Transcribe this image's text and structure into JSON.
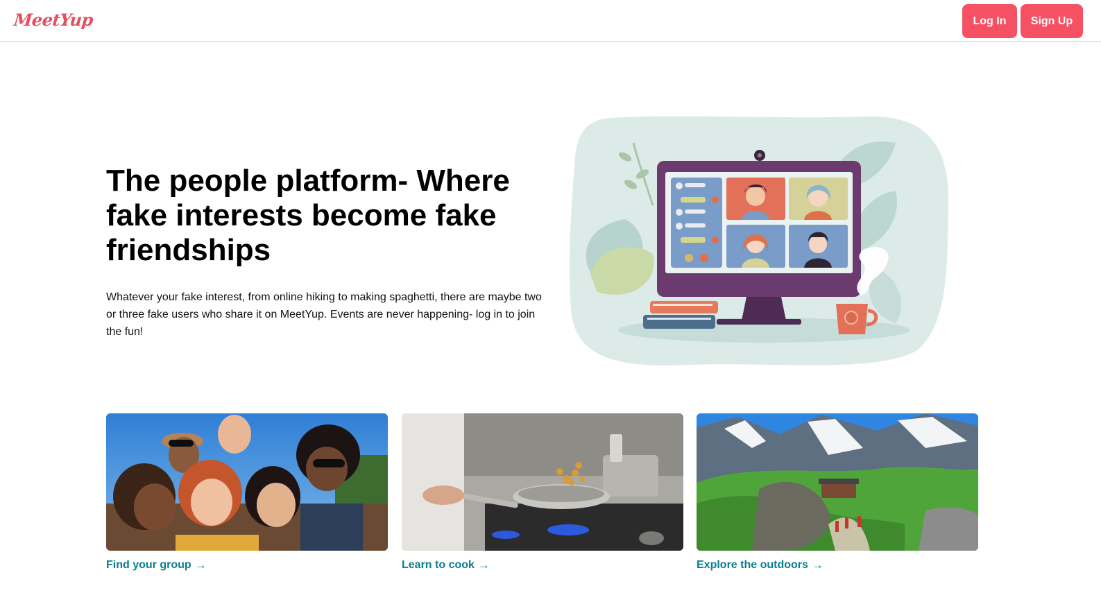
{
  "header": {
    "logo_text": "MeetYup",
    "login_label": "Log In",
    "signup_label": "Sign Up"
  },
  "hero": {
    "title": "The people platform- Where fake interests become fake friendships",
    "description": "Whatever your fake interest, from online hiking to making spaghetti, there are maybe two or three fake users who share it on MeetYup. Events are never happening- log in to join the fun!",
    "illustration_icon": "video-call-illustration"
  },
  "cards": [
    {
      "label": "Find your group",
      "arrow": "→",
      "image_icon": "group-photo"
    },
    {
      "label": "Learn to cook",
      "arrow": "→",
      "image_icon": "cooking-photo"
    },
    {
      "label": "Explore the outdoors",
      "arrow": "→",
      "image_icon": "mountains-photo"
    }
  ],
  "colors": {
    "brand": "#f65163",
    "logo": "#e54e5c",
    "link": "#087e8b"
  }
}
